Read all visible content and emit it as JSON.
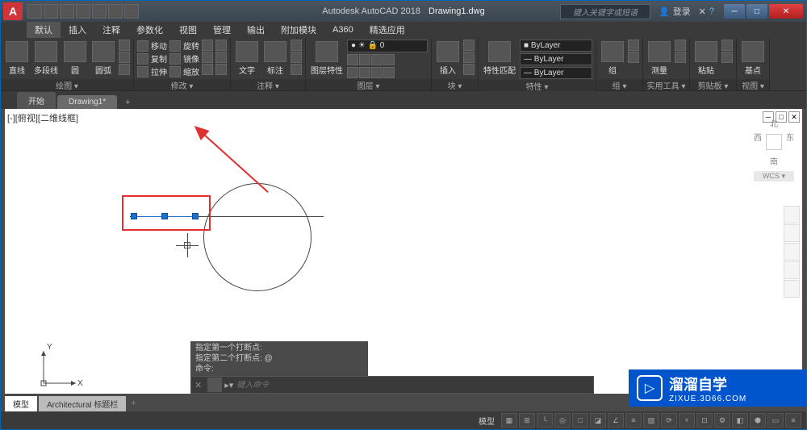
{
  "title": {
    "app": "Autodesk AutoCAD 2018",
    "doc": "Drawing1.dwg"
  },
  "search_hint": "键入关键字或短语",
  "login": "登录",
  "win": {
    "min": "─",
    "max": "□",
    "close": "✕"
  },
  "menu": [
    "默认",
    "插入",
    "注释",
    "参数化",
    "视图",
    "管理",
    "输出",
    "附加模块",
    "A360",
    "精选应用"
  ],
  "panels": {
    "draw": {
      "label": "绘图 ▾",
      "line": "直线",
      "polyline": "多段线",
      "circle": "圆",
      "arc": "圆弧"
    },
    "modify": {
      "label": "修改 ▾",
      "move": "移动",
      "copy": "复制",
      "stretch": "拉伸",
      "rotate": "旋转",
      "mirror": "镜像",
      "scale": "缩放"
    },
    "annot": {
      "label": "注释 ▾",
      "text": "文字",
      "dim": "标注"
    },
    "layer": {
      "label": "图层 ▾",
      "btn": "图层特性",
      "current": "0"
    },
    "block": {
      "label": "块 ▾",
      "insert": "插入"
    },
    "props": {
      "label": "特性 ▾",
      "btn": "特性匹配",
      "bylayer": "ByLayer"
    },
    "group": {
      "label": "组 ▾",
      "btn": "组"
    },
    "util": {
      "label": "实用工具 ▾",
      "measure": "测量"
    },
    "clip": {
      "label": "剪贴板 ▾",
      "paste": "粘贴"
    },
    "view": {
      "label": "视图 ▾",
      "base": "基点"
    }
  },
  "tabs": {
    "start": "开始",
    "drawing": "Drawing1*",
    "add": "+"
  },
  "viewport": {
    "label": "[-][俯视][二维线框]",
    "min": "─",
    "max": "□",
    "close": "✕"
  },
  "ucs": {
    "x": "X",
    "y": "Y"
  },
  "viewcube": {
    "n": "北",
    "w": "西",
    "e": "东",
    "s": "南",
    "wcs": "WCS ▾"
  },
  "cmd": {
    "h1": "指定第一个打断点:",
    "h2": "指定第二个打断点: @",
    "h3": "命令:",
    "placeholder": "键入命令"
  },
  "btabs": {
    "model": "模型",
    "layout": "Architectural 标题栏"
  },
  "status": {
    "model": "模型"
  },
  "watermark": {
    "main": "溜溜自学",
    "sub": "ZIXUE.3D66.COM",
    "play": "▷"
  }
}
